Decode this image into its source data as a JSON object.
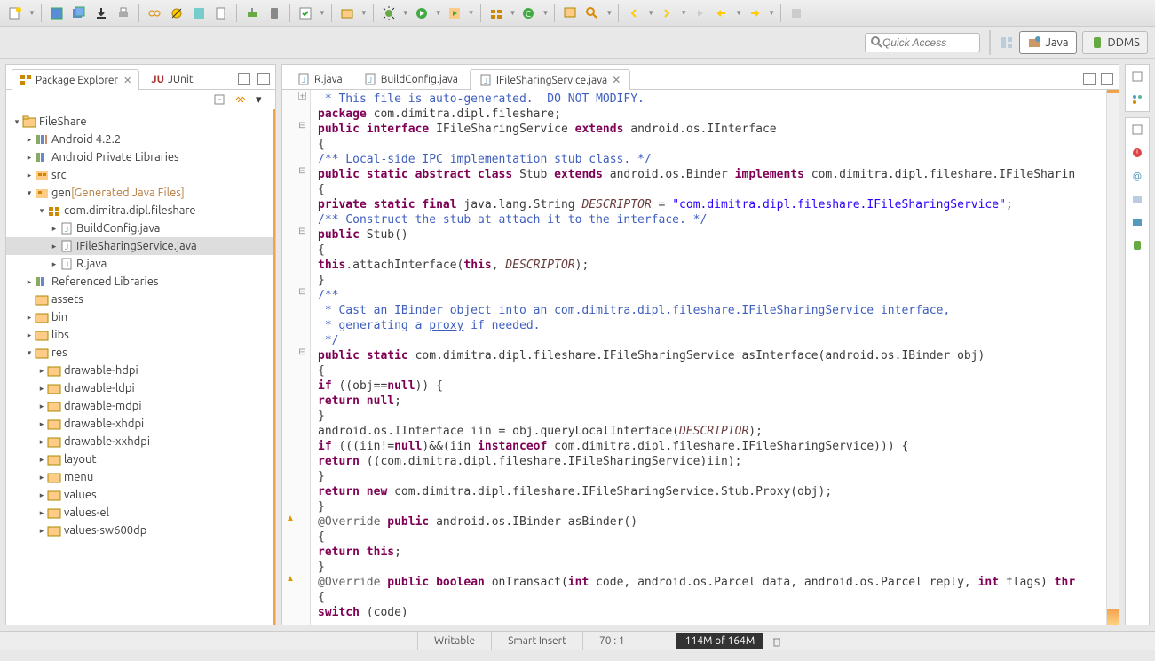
{
  "quickAccess": {
    "placeholder": "Quick Access"
  },
  "perspectives": {
    "java": "Java",
    "ddms": "DDMS"
  },
  "views": {
    "pkgExp": "Package Explorer",
    "junit": "JUnit"
  },
  "tree": {
    "project": "FileShare",
    "android": "Android 4.2.2",
    "privLib": "Android Private Libraries",
    "src": "src",
    "gen": "gen",
    "genDecor": "[Generated Java Files]",
    "pkg": "com.dimitra.dipl.fileshare",
    "buildConfig": "BuildConfig.java",
    "ifile": "IFileSharingService.java",
    "rjava": "R.java",
    "refLib": "Referenced Libraries",
    "assets": "assets",
    "bin": "bin",
    "libs": "libs",
    "res": "res",
    "dhdpi": "drawable-hdpi",
    "dldpi": "drawable-ldpi",
    "dmdpi": "drawable-mdpi",
    "dxhdpi": "drawable-xhdpi",
    "dxxhdpi": "drawable-xxhdpi",
    "layout": "layout",
    "menu": "menu",
    "values": "values",
    "valuesEl": "values-el",
    "valuesSw": "values-sw600dp"
  },
  "editorTabs": {
    "r": "R.java",
    "bc": "BuildConfig.java",
    "ifile": "IFileSharingService.java"
  },
  "code": {
    "l1a": " * This file is auto-generated.  DO NOT MODIFY.",
    "l2a": "package",
    "l2b": " com.dimitra.dipl.fileshare;",
    "l3a": "public",
    "l3b": "interface",
    "l3c": " IFileSharingService ",
    "l3d": "extends",
    "l3e": " android.os.IInterface",
    "l4": "{",
    "l5": "/** Local-side IPC implementation stub class. */",
    "l6a": "public",
    "l6b": "static",
    "l6c": "abstract",
    "l6d": "class",
    "l6e": " Stub ",
    "l6f": "extends",
    "l6g": " android.os.Binder ",
    "l6h": "implements",
    "l6i": " com.dimitra.dipl.fileshare.IFileSharin",
    "l7": "{",
    "l8a": "private",
    "l8b": "static",
    "l8c": "final",
    "l8d": " java.lang.String ",
    "l8e": "DESCRIPTOR",
    "l8f": " = ",
    "l8g": "\"com.dimitra.dipl.fileshare.IFileSharingService\"",
    "l8h": ";",
    "l9": "/** Construct the stub at attach it to the interface. */",
    "l10a": "public",
    "l10b": " Stub()",
    "l11": "{",
    "l12a": "this",
    "l12b": ".attachInterface(",
    "l12c": "this",
    "l12d": ", ",
    "l12e": "DESCRIPTOR",
    "l12f": ");",
    "l13": "}",
    "l14": "/**",
    "l15": " * Cast an IBinder object into an com.dimitra.dipl.fileshare.IFileSharingService interface,",
    "l16a": " * generating a ",
    "l16b": "proxy",
    "l16c": " if needed.",
    "l17": " */",
    "l18a": "public",
    "l18b": "static",
    "l18c": " com.dimitra.dipl.fileshare.IFileSharingService asInterface(android.os.IBinder obj)",
    "l19": "{",
    "l20a": "if",
    "l20b": " ((obj==",
    "l20c": "null",
    "l20d": ")) {",
    "l21a": "return",
    "l21b": "null",
    "l21c": ";",
    "l22": "}",
    "l23a": "android.os.IInterface iin = obj.queryLocalInterface(",
    "l23b": "DESCRIPTOR",
    "l23c": ");",
    "l24a": "if",
    "l24b": " (((iin!=",
    "l24c": "null",
    "l24d": ")&&(iin ",
    "l24e": "instanceof",
    "l24f": " com.dimitra.dipl.fileshare.IFileSharingService))) {",
    "l25a": "return",
    "l25b": " ((com.dimitra.dipl.fileshare.IFileSharingService)iin);",
    "l26": "}",
    "l27a": "return",
    "l27b": "new",
    "l27c": " com.dimitra.dipl.fileshare.IFileSharingService.Stub.Proxy(obj);",
    "l28": "}",
    "l29a": "@Override",
    "l29b": "public",
    "l29c": " android.os.IBinder asBinder()",
    "l30": "{",
    "l31a": "return",
    "l31b": "this",
    "l31c": ";",
    "l32": "}",
    "l33a": "@Override",
    "l33b": "public",
    "l33c": "boolean",
    "l33d": " onTransact(",
    "l33e": "int",
    "l33f": " code, android.os.Parcel data, android.os.Parcel reply, ",
    "l33g": "int",
    "l33h": " flags) ",
    "l33i": "thr",
    "l34": "{",
    "l35a": "switch",
    "l35b": " (code)"
  },
  "status": {
    "writable": "Writable",
    "insert": "Smart Insert",
    "pos": "70 : 1",
    "heap": "114M of 164M"
  }
}
